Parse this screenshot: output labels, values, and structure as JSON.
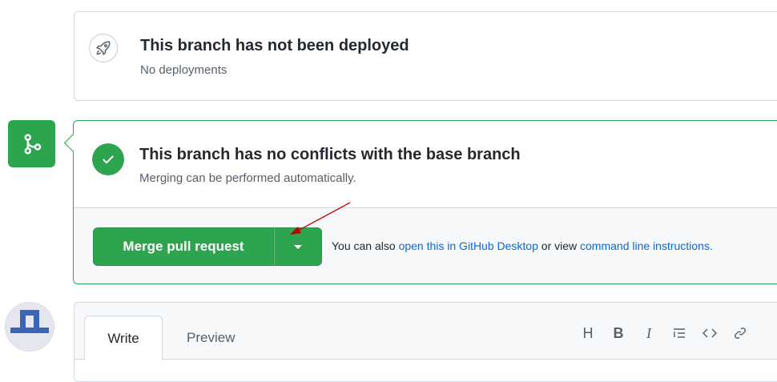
{
  "deploy": {
    "title": "This branch has not been deployed",
    "subtitle": "No deployments"
  },
  "merge": {
    "title": "This branch has no conflicts with the base branch",
    "subtitle": "Merging can be performed automatically.",
    "button_label": "Merge pull request",
    "also_prefix": "You can also ",
    "desktop_link": "open this in GitHub Desktop",
    "also_middle": " or view ",
    "cli_link": "command line instructions."
  },
  "comment": {
    "tab_write": "Write",
    "tab_preview": "Preview",
    "tools": {
      "heading": "H",
      "bold": "B",
      "italic": "I"
    }
  },
  "colors": {
    "success": "#2da44e",
    "link": "#0969da",
    "annotation_arrow": "#c00000"
  },
  "icons": [
    "rocket-icon",
    "git-merge-icon",
    "check-icon",
    "caret-down-icon",
    "list-icon",
    "code-icon",
    "link-icon"
  ]
}
